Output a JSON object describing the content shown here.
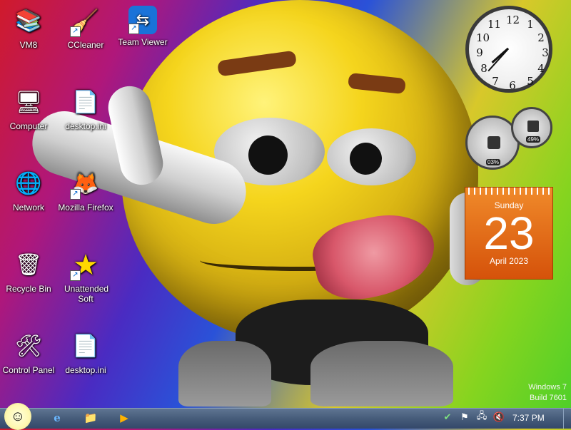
{
  "desktop": {
    "icons": [
      {
        "label": "VM8",
        "glyph": "📚",
        "shortcut": false
      },
      {
        "label": "CCleaner",
        "glyph": "🧹",
        "shortcut": true
      },
      {
        "label": "Team Viewer",
        "glyph": "⇆",
        "shortcut": true
      },
      {
        "label": "Computer",
        "glyph": "🖥",
        "shortcut": false
      },
      {
        "label": "desktop.ini",
        "glyph": "📄",
        "shortcut": false
      },
      {
        "label": "Network",
        "glyph": "🌐",
        "shortcut": false
      },
      {
        "label": "Mozilla Firefox",
        "glyph": "🦊",
        "shortcut": true
      },
      {
        "label": "Recycle Bin",
        "glyph": "🗑",
        "shortcut": false
      },
      {
        "label": "Unattended Soft",
        "glyph": "★",
        "shortcut": true
      },
      {
        "label": "Control Panel",
        "glyph": "🛠",
        "shortcut": false
      },
      {
        "label": "desktop.ini",
        "glyph": "📄",
        "shortcut": false
      }
    ]
  },
  "gadgets": {
    "clock": {
      "numbers": [
        "12",
        "1",
        "2",
        "3",
        "4",
        "5",
        "6",
        "7",
        "8",
        "9",
        "10",
        "11"
      ],
      "hour": 7,
      "minute": 37
    },
    "cpu_meter": {
      "cpu": "03%",
      "memory": "49%"
    },
    "calendar": {
      "weekday": "Sunday",
      "day": "23",
      "month_year": "April 2023"
    }
  },
  "watermark": {
    "line1": "Windows 7",
    "line2": "Build 7601"
  },
  "taskbar": {
    "start_glyph": "☺",
    "pinned": [
      {
        "name": "ie",
        "glyph": "e"
      },
      {
        "name": "explorer",
        "glyph": "📁"
      },
      {
        "name": "media-player",
        "glyph": "▶"
      }
    ],
    "tray": [
      "✔",
      "⚑",
      "🖧",
      "🔇"
    ],
    "time": "7:37 PM"
  },
  "colors": {
    "taskbar": "#465c7a",
    "calendar": "#e0661a"
  }
}
